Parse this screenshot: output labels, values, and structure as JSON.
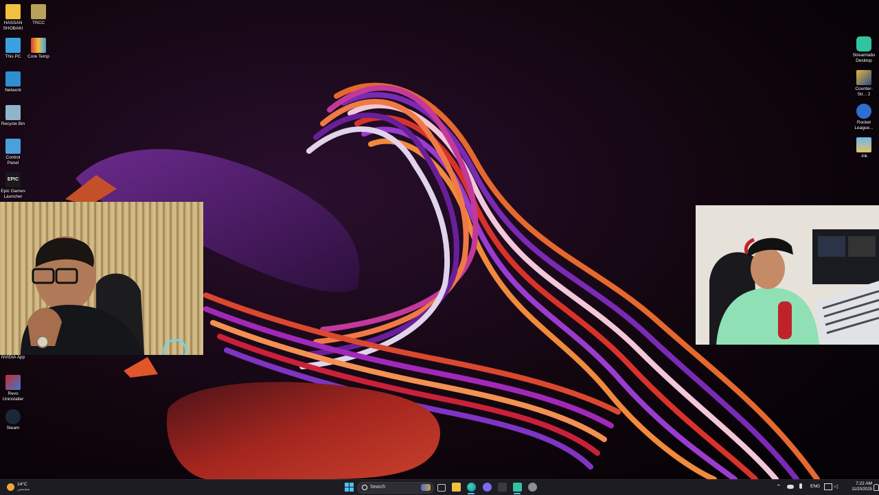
{
  "desktop_left": [
    {
      "label": "HASSAN SHOBAKI",
      "icon": "folder-icon"
    },
    {
      "label": "TRCC",
      "icon": "folder-icon"
    },
    {
      "label": "This PC",
      "icon": "monitor-icon"
    },
    {
      "label": "Core Temp",
      "icon": "thermometer-icon"
    },
    {
      "label": "Network",
      "icon": "network-icon"
    },
    {
      "label": "Recycle Bin",
      "icon": "recycle-bin-icon"
    },
    {
      "label": "Control Panel",
      "icon": "control-panel-icon"
    },
    {
      "label": "Epic Games Launcher",
      "icon": "epic-games-icon",
      "logo_text": "EPIC"
    },
    {
      "label": "NVIDIA App",
      "icon": "nvidia-icon"
    },
    {
      "label": "Revo Uninstaller",
      "icon": "revo-uninstaller-icon"
    },
    {
      "label": "Steam",
      "icon": "steam-icon"
    }
  ],
  "desktop_right": [
    {
      "label": "Streamlabs Desktop",
      "icon": "streamlabs-icon"
    },
    {
      "label": "Counter-Str... 2",
      "icon": "counter-strike-icon"
    },
    {
      "label": "Rocket League...",
      "icon": "rocket-league-icon"
    },
    {
      "label": ".lnk",
      "icon": "shortcut-icon"
    }
  ],
  "taskbar": {
    "weather_temp": "14°C",
    "weather_desc": "مشمس",
    "search_placeholder": "Search",
    "language": "ENG",
    "time": "7:22 AM",
    "date": "11/20/2025"
  },
  "colors": {
    "taskbar_bg": "#1d1c22",
    "wallpaper_bg": "#0a0509",
    "accent_purple": "#7b2fa8",
    "accent_orange": "#e8672c"
  }
}
